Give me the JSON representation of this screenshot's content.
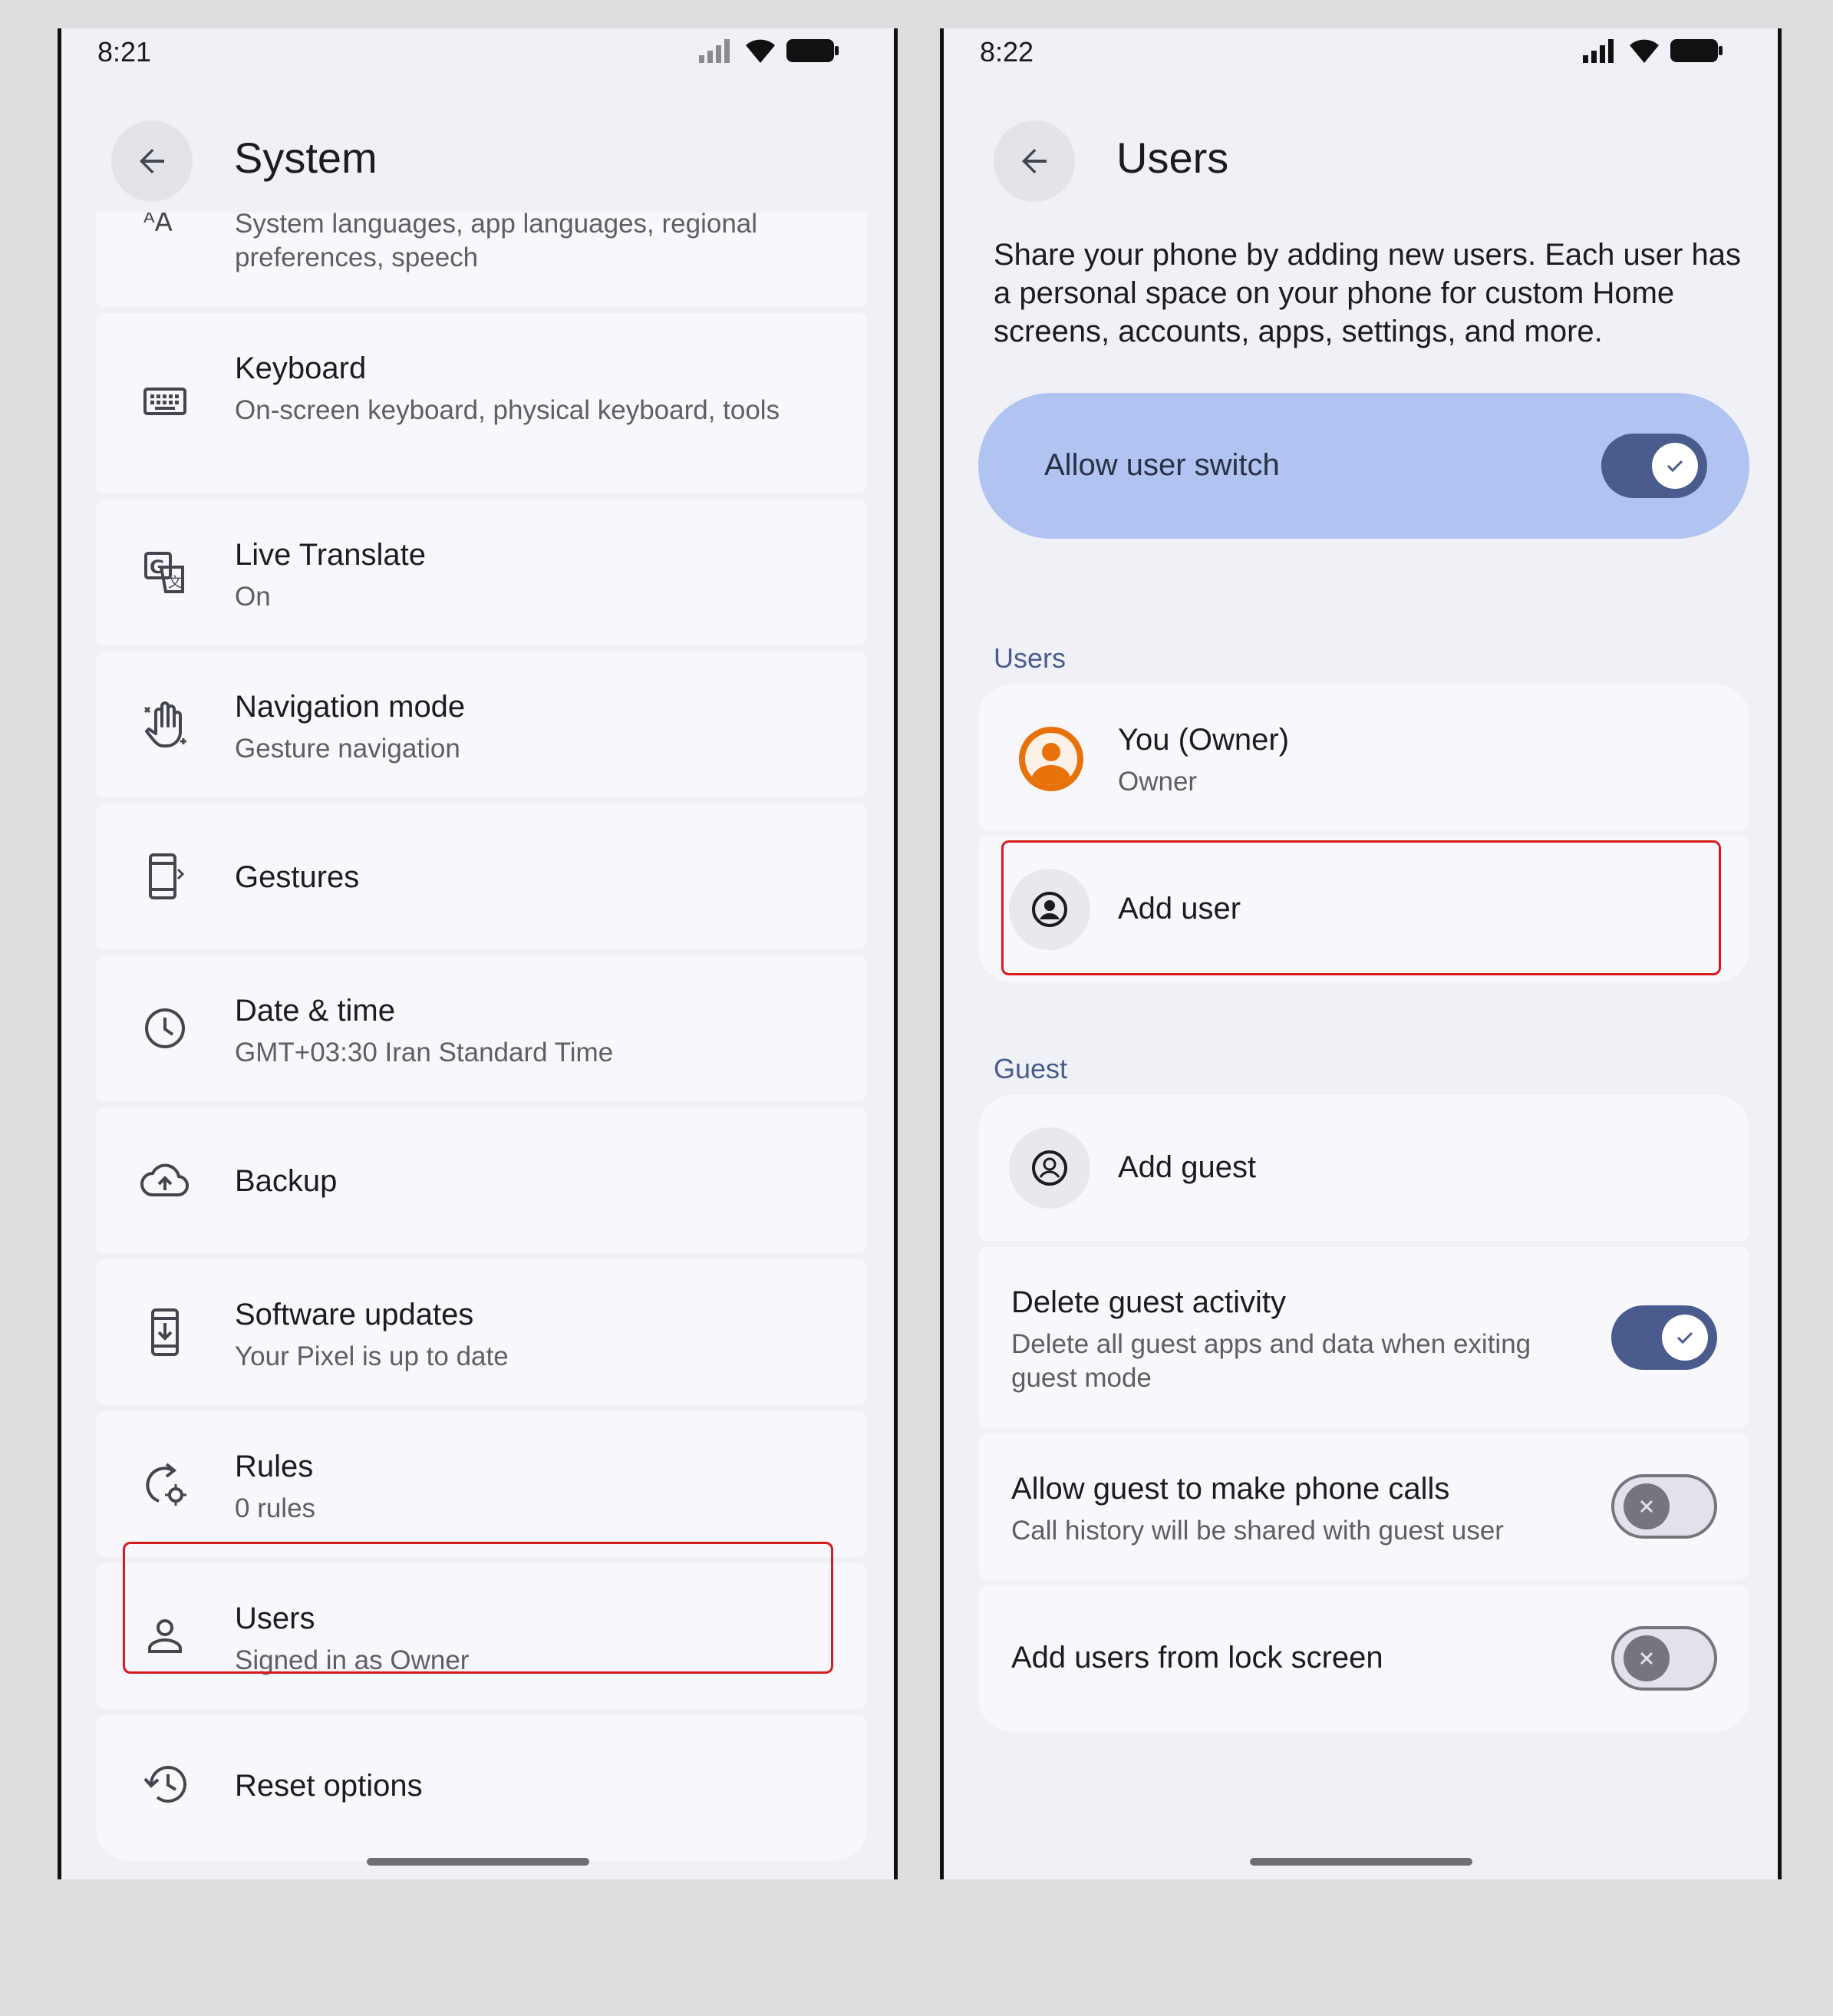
{
  "left": {
    "status": {
      "time": "8:21"
    },
    "title": "System",
    "items": [
      {
        "icon": "language-icon",
        "title": "",
        "subtitle": "System languages, app languages, regional preferences, speech"
      },
      {
        "icon": "keyboard-icon",
        "title": "Keyboard",
        "subtitle": "On-screen keyboard, physical keyboard, tools"
      },
      {
        "icon": "translate-icon",
        "title": "Live Translate",
        "subtitle": "On"
      },
      {
        "icon": "gesture-hand-icon",
        "title": "Navigation mode",
        "subtitle": "Gesture navigation"
      },
      {
        "icon": "phone-gesture-icon",
        "title": "Gestures",
        "subtitle": ""
      },
      {
        "icon": "clock-icon",
        "title": "Date & time",
        "subtitle": "GMT+03:30 Iran Standard Time"
      },
      {
        "icon": "cloud-upload-icon",
        "title": "Backup",
        "subtitle": ""
      },
      {
        "icon": "system-update-icon",
        "title": "Software updates",
        "subtitle": "Your Pixel is up to date"
      },
      {
        "icon": "rules-icon",
        "title": "Rules",
        "subtitle": "0 rules"
      },
      {
        "icon": "person-icon",
        "title": "Users",
        "subtitle": "Signed in as Owner"
      },
      {
        "icon": "history-icon",
        "title": "Reset options",
        "subtitle": ""
      }
    ]
  },
  "right": {
    "status": {
      "time": "8:22"
    },
    "title": "Users",
    "description": "Share your phone by adding new users. Each user has a personal space on your phone for custom Home screens, accounts, apps, settings, and more.",
    "allow_switch": {
      "label": "Allow user switch",
      "on": true
    },
    "users_section": "Users",
    "owner": {
      "title": "You (Owner)",
      "subtitle": "Owner"
    },
    "add_user": "Add user",
    "guest_section": "Guest",
    "add_guest": "Add guest",
    "delete_guest": {
      "title": "Delete guest activity",
      "subtitle": "Delete all guest apps and data when exiting guest mode",
      "on": true
    },
    "guest_calls": {
      "title": "Allow guest to make phone calls",
      "subtitle": "Call history will be shared with guest user",
      "on": false
    },
    "lock_screen": {
      "title": "Add users from lock screen",
      "on": false
    }
  },
  "colors": {
    "accent": "#4a5b8e",
    "switch_card": "#b0c3f1",
    "highlight": "#d81b1b",
    "owner_avatar": "#e8710a"
  }
}
